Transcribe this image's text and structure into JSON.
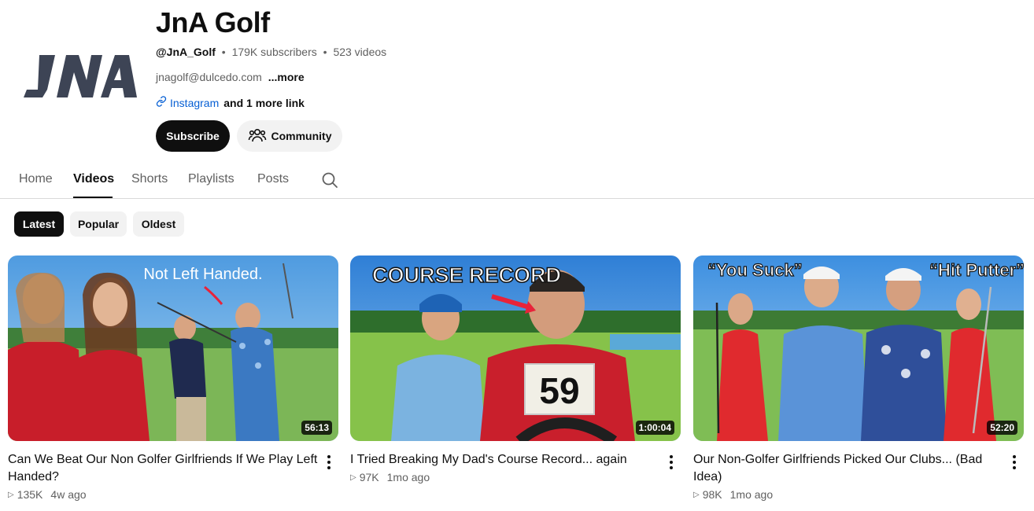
{
  "channel": {
    "name": "JnA Golf",
    "handle": "@JnA_Golf",
    "subscribers": "179K subscribers",
    "videos_count": "523 videos",
    "separator": "•",
    "email": "jnagolf@dulcedo.com",
    "more_label": "...more",
    "link_label": "Instagram",
    "more_links": "and 1 more link",
    "logo_text": "JNA"
  },
  "actions": {
    "subscribe": "Subscribe",
    "community": "Community"
  },
  "tabs": [
    {
      "label": "Home"
    },
    {
      "label": "Videos"
    },
    {
      "label": "Shorts"
    },
    {
      "label": "Playlists"
    },
    {
      "label": "Posts"
    }
  ],
  "active_tab": "Videos",
  "chips": [
    {
      "label": "Latest"
    },
    {
      "label": "Popular"
    },
    {
      "label": "Oldest"
    }
  ],
  "active_chip": "Latest",
  "videos": [
    {
      "title": "Can We Beat Our Non Golfer Girlfriends If We Play Left Handed?",
      "duration": "56:13",
      "views": "135K",
      "age": "4w ago",
      "thumb_text": "Not Left Handed."
    },
    {
      "title": "I Tried Breaking My Dad's Course Record... again",
      "duration": "1:00:04",
      "views": "97K",
      "age": "1mo ago",
      "thumb_text": "COURSE RECORD",
      "thumb_score": "59"
    },
    {
      "title": "Our Non-Golfer Girlfriends Picked Our Clubs... (Bad Idea)",
      "duration": "52:20",
      "views": "98K",
      "age": "1mo ago",
      "thumb_text_left": "“You Suck”",
      "thumb_text_right": "“Hit Putter”"
    }
  ],
  "colors": {
    "link": "#065fd4",
    "primary_button": "#0f0f0f",
    "secondary_button": "#f2f2f2",
    "logo": "#3d4455"
  },
  "icons": {
    "link": "link-icon",
    "community": "people-icon",
    "search": "search-icon",
    "views": "play-triangle-icon",
    "menu": "more-vertical-icon"
  }
}
